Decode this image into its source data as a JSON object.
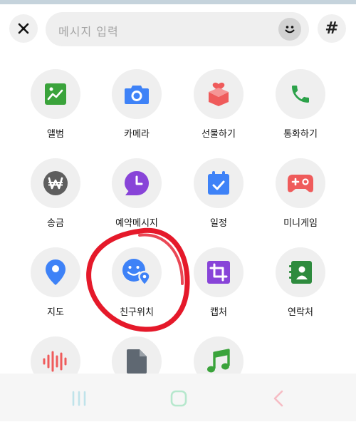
{
  "input": {
    "placeholder": "메시지 입력"
  },
  "header": {
    "hash_label": "#"
  },
  "menu": {
    "items": [
      {
        "label": "앨범",
        "icon": "album-icon",
        "color": "#3aa33b"
      },
      {
        "label": "카메라",
        "icon": "camera-icon",
        "color": "#3e82f7"
      },
      {
        "label": "선물하기",
        "icon": "gift-icon",
        "color": "#ef5b5b"
      },
      {
        "label": "통화하기",
        "icon": "phone-icon",
        "color": "#2ca24a"
      },
      {
        "label": "송금",
        "icon": "won-icon",
        "color": "#5e5e5e"
      },
      {
        "label": "예약메시지",
        "icon": "scheduled-message-icon",
        "color": "#8844d8"
      },
      {
        "label": "일정",
        "icon": "calendar-icon",
        "color": "#3e82f7"
      },
      {
        "label": "미니게임",
        "icon": "gamepad-icon",
        "color": "#ef5b5b"
      },
      {
        "label": "지도",
        "icon": "map-pin-icon",
        "color": "#3e82f7"
      },
      {
        "label": "친구위치",
        "icon": "friend-location-icon",
        "color": "#3e82f7"
      },
      {
        "label": "캡처",
        "icon": "crop-icon",
        "color": "#8844d8"
      },
      {
        "label": "연락처",
        "icon": "contact-icon",
        "color": "#2e8b3e"
      },
      {
        "label": "",
        "icon": "voice-icon",
        "color": "#ef5b5b"
      },
      {
        "label": "",
        "icon": "file-icon",
        "color": "#5f6872"
      },
      {
        "label": "",
        "icon": "music-icon",
        "color": "#3aa33b"
      }
    ]
  },
  "annotation": {
    "color": "#e5192a"
  },
  "nav": {
    "icons": [
      "recent-apps-icon",
      "home-icon",
      "back-icon"
    ]
  }
}
